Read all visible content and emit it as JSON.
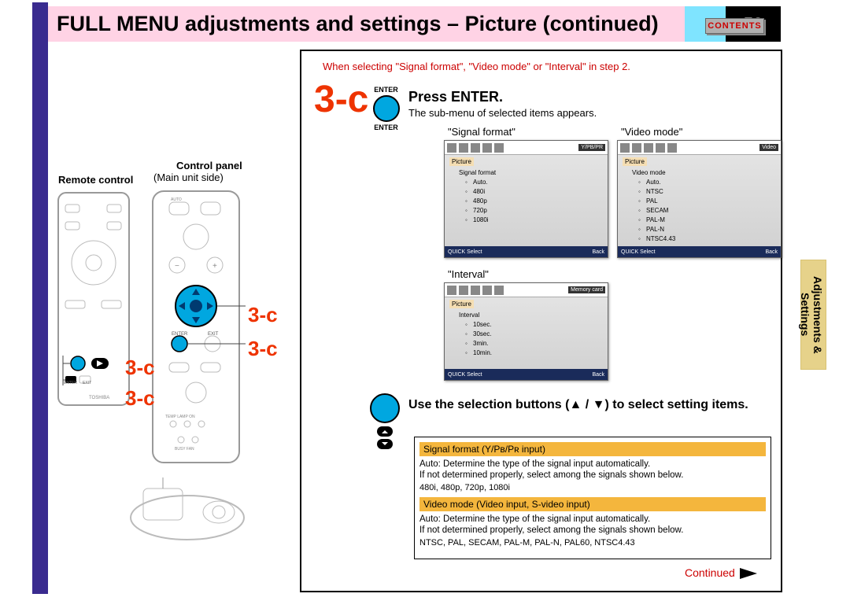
{
  "page_number": "58",
  "contents_btn": "CONTENTS",
  "title": "FULL MENU adjustments and settings – Picture (continued)",
  "side_tab": "Adjustments &\nSettings",
  "red_note": "When selecting \"Signal format\", \"Video mode\" or \"Interval\"  in step 2.",
  "step_id": "3-c",
  "enter": {
    "top": "ENTER",
    "bottom": "ENTER"
  },
  "step_title": "Press ENTER.",
  "step_sub": "The sub-menu of selected items appears.",
  "captions": {
    "sf": "\"Signal format\"",
    "vm": "\"Video mode\"",
    "iv": "\"Interval\""
  },
  "menus": {
    "sf": {
      "tag": "Y/PB/PR",
      "header": "Picture",
      "sub": "Signal format",
      "items": [
        "Auto.",
        "480i",
        "480p",
        "720p",
        "1080i"
      ],
      "foot_l": "QUICK  Select",
      "foot_r": "Back"
    },
    "vm": {
      "tag": "Video",
      "header": "Picture",
      "sub": "Video mode",
      "items": [
        "Auto.",
        "NTSC",
        "PAL",
        "SECAM",
        "PAL-M",
        "PAL-N",
        "NTSC4.43"
      ],
      "foot_l": "QUICK  Select",
      "foot_r": "Back"
    },
    "iv": {
      "tag": "Memory card",
      "header": "Picture",
      "sub": "Interval",
      "items": [
        "10sec.",
        "30sec.",
        "3min.",
        "10min."
      ],
      "foot_l": "QUICK  Select",
      "foot_r": "Back"
    }
  },
  "step2_title": "Use the selection buttons (▲ / ▼) to select setting items.",
  "info": {
    "h1": "Signal format (Y/Pʙ/Pʀ input)",
    "p1a": "Auto:   Determine the type of the signal input automatically.",
    "p1b": "If not determined properly, select among the signals shown below.",
    "s1": "480i, 480p, 720p, 1080i",
    "h2": "Video mode (Video input, S-video input)",
    "p2a": "Auto:   Determine the type of the signal input automatically.",
    "p2b": "If not determined properly, select among the signals shown below.",
    "s2": "NTSC, PAL, SECAM, PAL-M, PAL-N, PAL60, NTSC4.43"
  },
  "continued": "Continued",
  "left": {
    "remote": "Remote control",
    "cp": "Control panel",
    "main": "(Main  unit  side)"
  },
  "step_labels": [
    "3-c",
    "3-c",
    "3-c",
    "3-c"
  ]
}
